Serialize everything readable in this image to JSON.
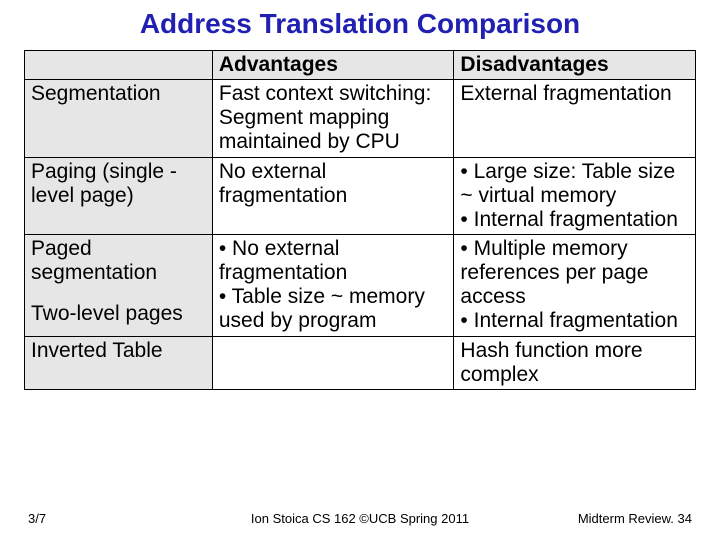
{
  "title": "Address Translation Comparison",
  "headers": {
    "blank": "",
    "adv": "Advantages",
    "dis": "Disadvantages"
  },
  "rows": {
    "r1": {
      "name": "Segmentation",
      "adv": "Fast context switching: Segment mapping maintained by CPU",
      "dis": "External fragmentation"
    },
    "r2": {
      "name": "Paging (single -level page)",
      "adv": "No external fragmentation",
      "dis": "• Large size: Table size ~ virtual memory\n• Internal fragmentation"
    },
    "r3": {
      "name_a": "Paged segmentation",
      "name_b": "Two-level pages",
      "adv": "• No external fragmentation\n• Table size ~ memory used by  program",
      "dis": "• Multiple memory references per page access\n• Internal fragmentation"
    },
    "r4": {
      "name": "Inverted Table",
      "adv": "",
      "dis": "Hash function more complex"
    }
  },
  "footer": {
    "left": "3/7",
    "center": "Ion Stoica CS 162 ©UCB Spring 2011",
    "right": "Midterm Review. 34"
  }
}
